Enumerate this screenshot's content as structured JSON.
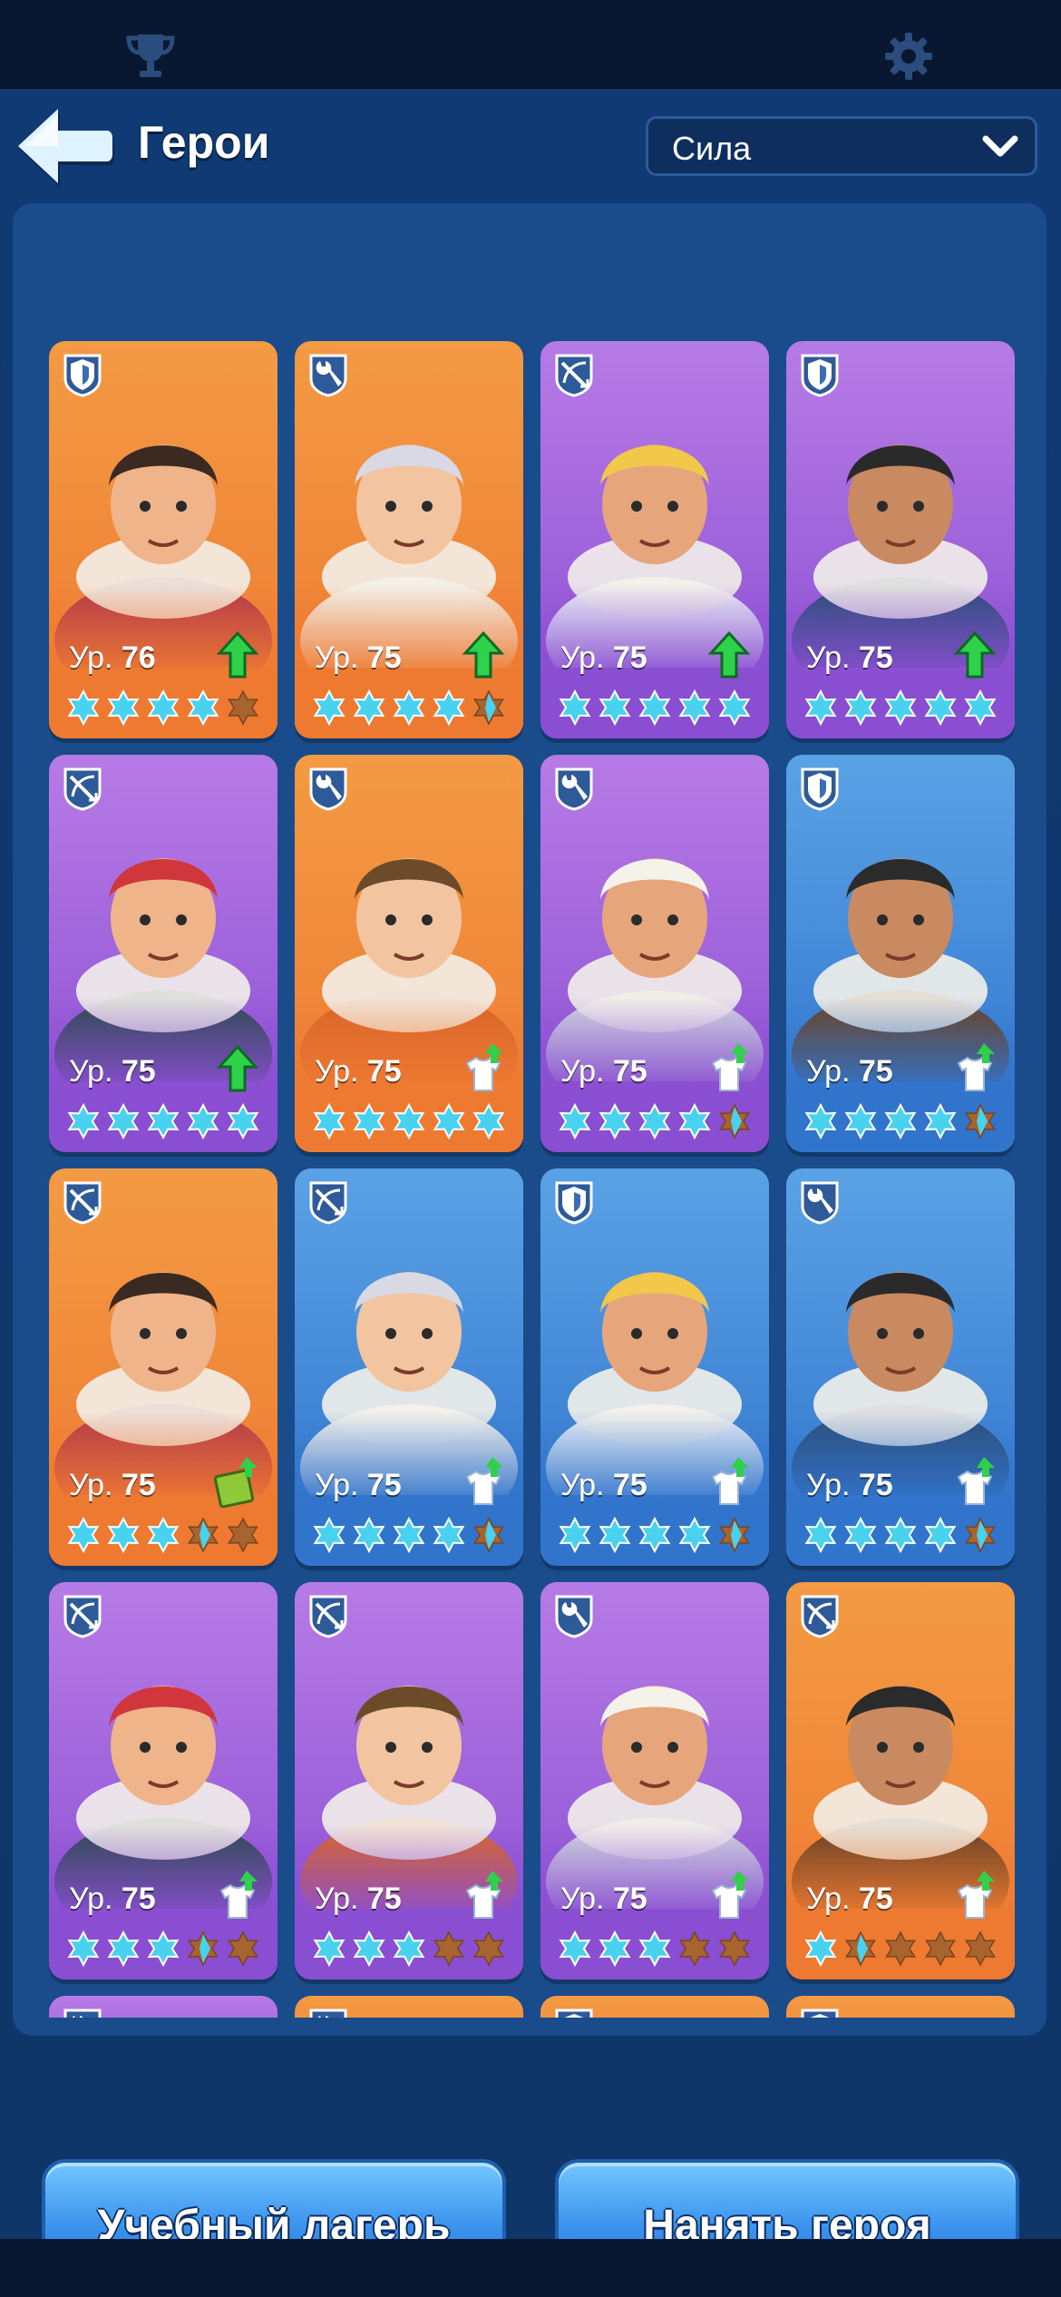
{
  "topbar": {
    "left_icon": "trophy-icon",
    "right_icon": "gear-icon"
  },
  "header": {
    "title": "Герои",
    "back_icon": "back-arrow-icon"
  },
  "sort": {
    "value": "Сила",
    "icon": "chevron-down-icon"
  },
  "level_prefix": "Ур.",
  "heroes": [
    {
      "level": "76",
      "rarity": "orange",
      "role": "shield-icon",
      "stars": 4,
      "upgrade": "arrow"
    },
    {
      "level": "75",
      "rarity": "orange",
      "role": "wrench-icon",
      "stars": 4.5,
      "upgrade": "arrow"
    },
    {
      "level": "75",
      "rarity": "purple",
      "role": "crossbow-icon",
      "stars": 5,
      "upgrade": "arrow"
    },
    {
      "level": "75",
      "rarity": "purple",
      "role": "shield-icon",
      "stars": 5,
      "upgrade": "arrow"
    },
    {
      "level": "75",
      "rarity": "purple",
      "role": "crossbow-icon",
      "stars": 5,
      "upgrade": "arrow"
    },
    {
      "level": "75",
      "rarity": "orange",
      "role": "wrench-icon",
      "stars": 5,
      "upgrade": "shirt"
    },
    {
      "level": "75",
      "rarity": "purple",
      "role": "wrench-icon",
      "stars": 4.5,
      "upgrade": "shirt"
    },
    {
      "level": "75",
      "rarity": "blue",
      "role": "shield-icon",
      "stars": 4.5,
      "upgrade": "shirt"
    },
    {
      "level": "75",
      "rarity": "orange",
      "role": "crossbow-icon",
      "stars": 3.5,
      "upgrade": "book"
    },
    {
      "level": "75",
      "rarity": "blue",
      "role": "crossbow-icon",
      "stars": 4.5,
      "upgrade": "shirt"
    },
    {
      "level": "75",
      "rarity": "blue",
      "role": "shield-icon",
      "stars": 4.5,
      "upgrade": "shirt"
    },
    {
      "level": "75",
      "rarity": "blue",
      "role": "wrench-icon",
      "stars": 4.5,
      "upgrade": "shirt"
    },
    {
      "level": "75",
      "rarity": "purple",
      "role": "crossbow-icon",
      "stars": 3.5,
      "upgrade": "shirt"
    },
    {
      "level": "75",
      "rarity": "purple",
      "role": "crossbow-icon",
      "stars": 3,
      "upgrade": "shirt"
    },
    {
      "level": "75",
      "rarity": "purple",
      "role": "wrench-icon",
      "stars": 3,
      "upgrade": "shirt"
    },
    {
      "level": "75",
      "rarity": "orange",
      "role": "crossbow-icon",
      "stars": 1.5,
      "upgrade": "shirt"
    }
  ],
  "partial_heroes": [
    {
      "rarity": "purple",
      "role": "wrench-icon"
    },
    {
      "rarity": "orange",
      "role": "wrench-icon"
    },
    {
      "rarity": "orange",
      "role": "shield-icon"
    },
    {
      "rarity": "orange",
      "role": "shield-icon"
    }
  ],
  "buttons": {
    "training_camp": "Учебный лагерь",
    "hire_hero": "Нанять героя"
  },
  "colors": {
    "star": "#49d2ef",
    "star_empty": "#a8642f",
    "upgrade_green": "#2fd14a"
  }
}
